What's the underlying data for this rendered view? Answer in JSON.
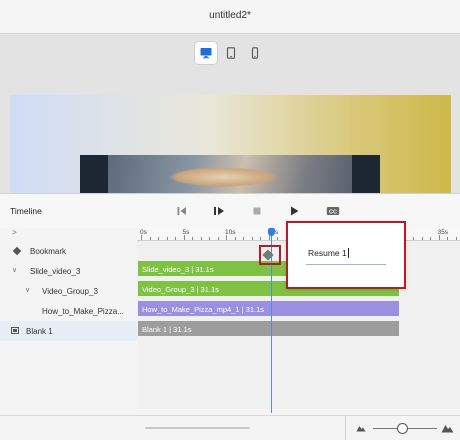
{
  "window": {
    "title": "untitled2*"
  },
  "devices": [
    {
      "name": "desktop",
      "active": true
    },
    {
      "name": "tablet",
      "active": false
    },
    {
      "name": "phone",
      "active": false
    }
  ],
  "timeline": {
    "title": "Timeline",
    "ruler_toggle": ">",
    "ruler": {
      "labels": [
        "0s",
        "5s",
        "10s",
        "15s",
        "35s"
      ]
    },
    "rows": [
      {
        "label": "Bookmark"
      },
      {
        "label": "Slide_video_3"
      },
      {
        "label": "Video_Group_3"
      },
      {
        "label": "How_to_Make_Pizza..."
      },
      {
        "label": "Blank 1"
      }
    ],
    "bars": [
      {
        "text": "Slide_video_3 | 31.1s"
      },
      {
        "text": "Video_Group_3 | 31.1s"
      },
      {
        "text": "How_to_Make_Pizza_mp4_1 | 31.1s"
      },
      {
        "text": "Blank 1 | 31.1s"
      }
    ],
    "bookmark_tail": "nd"
  },
  "popup": {
    "value": "Resume 1"
  },
  "colors": {
    "accent": "#2f7ee6",
    "highlight": "#b01e28",
    "green_bar": "#7fc142",
    "purple_bar": "#9b8fe0",
    "gray_bar": "#9d9d9d"
  }
}
